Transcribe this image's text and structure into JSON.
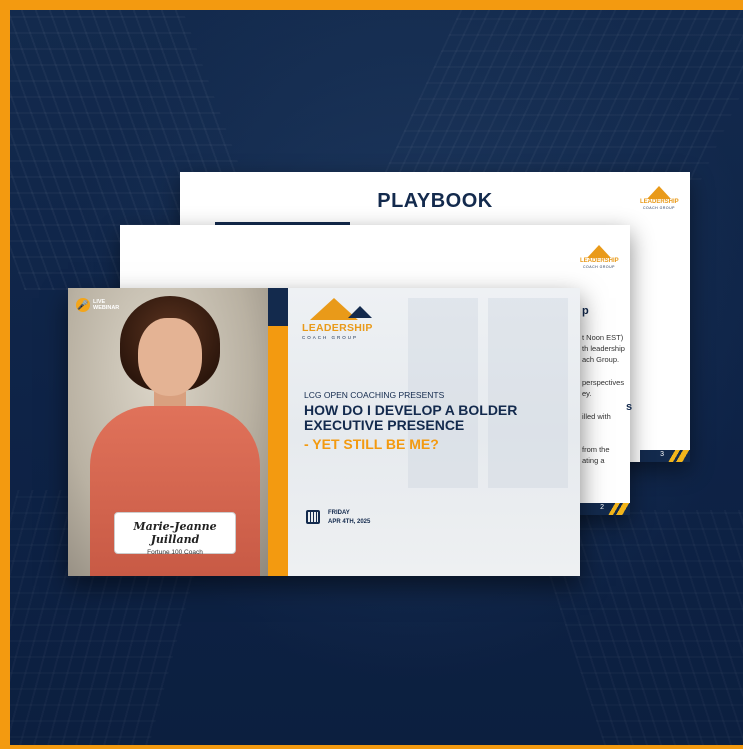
{
  "colors": {
    "frame": "#f39a10",
    "navy": "#132a4d",
    "accent": "#f39a10"
  },
  "playbook": {
    "title": "PLAYBOOK",
    "logo_line1": "LEADERSHIP",
    "logo_line2": "COACH GROUP",
    "page_number": "3"
  },
  "page2": {
    "logo_line1": "LEADERSHIP",
    "logo_line2": "COACH GROUP",
    "heading_fragment": "p",
    "text_lines": [
      "t Noon EST)",
      "th leadership",
      "ach Group.",
      "",
      "perspectives",
      "ey.",
      "",
      "illed with",
      "",
      "from the",
      "ating a"
    ],
    "subheading_fragment": "s",
    "page_number": "2"
  },
  "slide": {
    "badge_line1": "LIVE",
    "badge_line2": "WEBINAR",
    "person_name": "Marie-Jeanne Juilland",
    "person_role": "Fortune 100 Coach",
    "logo_line1": "LEADERSHIP",
    "logo_line2": "COACH GROUP",
    "presents": "LCG OPEN COACHING PRESENTS",
    "headline": "HOW DO I DEVELOP A BOLDER EXECUTIVE PRESENCE",
    "headline_accent": "- YET STILL BE ME?",
    "day": "FRIDAY",
    "date": "APR 4TH, 2025",
    "icons": [
      "microphone-icon",
      "calendar-icon",
      "mountain-logo-icon"
    ]
  }
}
